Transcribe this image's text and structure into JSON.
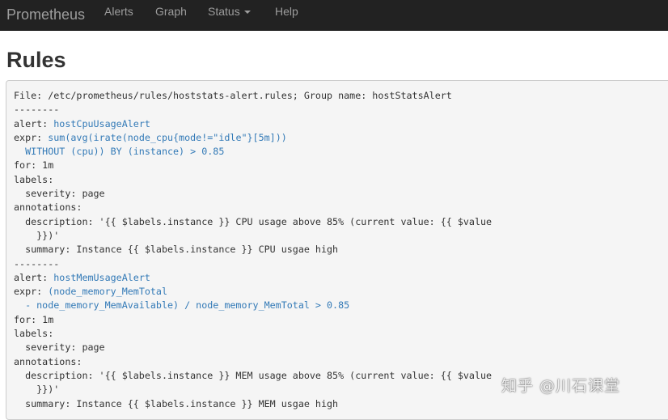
{
  "navbar": {
    "brand": "Prometheus",
    "items": [
      {
        "label": "Alerts"
      },
      {
        "label": "Graph"
      },
      {
        "label": "Status"
      },
      {
        "label": "Help"
      }
    ]
  },
  "page": {
    "title": "Rules"
  },
  "rules": {
    "header": "File: /etc/prometheus/rules/hoststats-alert.rules; Group name: hostStatsAlert",
    "separator": "--------",
    "groups": [
      {
        "alert_key": "alert: ",
        "alert_name": "hostCpuUsageAlert",
        "expr_key": "expr: ",
        "expr_line1": "sum(avg(irate(node_cpu{mode!=\"idle\"}[5m]))",
        "expr_line2": "  WITHOUT (cpu)) BY (instance) > 0.85",
        "for_line": "for: 1m",
        "labels_key": "labels:",
        "severity_line": "  severity: page",
        "annotations_key": "annotations:",
        "description_line1": "  description: '{{ $labels.instance }} CPU usage above 85% (current value: {{ $value",
        "description_line2": "    }})'",
        "summary_line": "  summary: Instance {{ $labels.instance }} CPU usgae high"
      },
      {
        "alert_key": "alert: ",
        "alert_name": "hostMemUsageAlert",
        "expr_key": "expr: ",
        "expr_line1": "(node_memory_MemTotal",
        "expr_line2": "  - node_memory_MemAvailable) / node_memory_MemTotal > 0.85",
        "for_line": "for: 1m",
        "labels_key": "labels:",
        "severity_line": "  severity: page",
        "annotations_key": "annotations:",
        "description_line1": "  description: '{{ $labels.instance }} MEM usage above 85% (current value: {{ $value",
        "description_line2": "    }})'",
        "summary_line": "  summary: Instance {{ $labels.instance }} MEM usgae high"
      }
    ]
  },
  "watermark": "知乎 @川石课堂",
  "colors": {
    "navbar_bg": "#222222",
    "nav_text": "#9d9d9d",
    "link": "#337ab7",
    "pre_bg": "#f5f5f5"
  }
}
